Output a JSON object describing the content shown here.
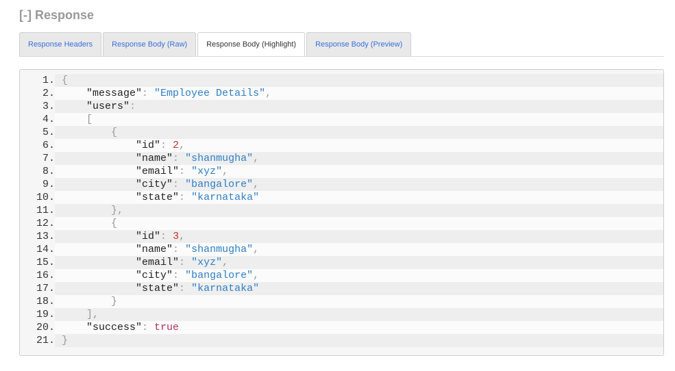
{
  "header": {
    "toggle": "[-]",
    "title": "Response"
  },
  "tabs": [
    {
      "label": "Response Headers",
      "active": false
    },
    {
      "label": "Response Body (Raw)",
      "active": false
    },
    {
      "label": "Response Body (Highlight)",
      "active": true
    },
    {
      "label": "Response Body (Preview)",
      "active": false
    }
  ],
  "code": {
    "line_numbers": [
      "1.",
      "2.",
      "3.",
      "4.",
      "5.",
      "6.",
      "7.",
      "8.",
      "9.",
      "10.",
      "11.",
      "12.",
      "13.",
      "14.",
      "15.",
      "16.",
      "17.",
      "18.",
      "19.",
      "20.",
      "21."
    ],
    "message_key": "\"message\"",
    "message_value": "\"Employee Details\"",
    "users_key": "\"users\"",
    "success_key": "\"success\"",
    "success_value": "true",
    "users": [
      {
        "id_key": "\"id\"",
        "id": "2",
        "name_key": "\"name\"",
        "name": "\"shanmugha\"",
        "email_key": "\"email\"",
        "email": "\"xyz\"",
        "city_key": "\"city\"",
        "city": "\"bangalore\"",
        "state_key": "\"state\"",
        "state": "\"karnataka\""
      },
      {
        "id_key": "\"id\"",
        "id": "3",
        "name_key": "\"name\"",
        "name": "\"shanmugha\"",
        "email_key": "\"email\"",
        "email": "\"xyz\"",
        "city_key": "\"city\"",
        "city": "\"bangalore\"",
        "state_key": "\"state\"",
        "state": "\"karnataka\""
      }
    ]
  }
}
